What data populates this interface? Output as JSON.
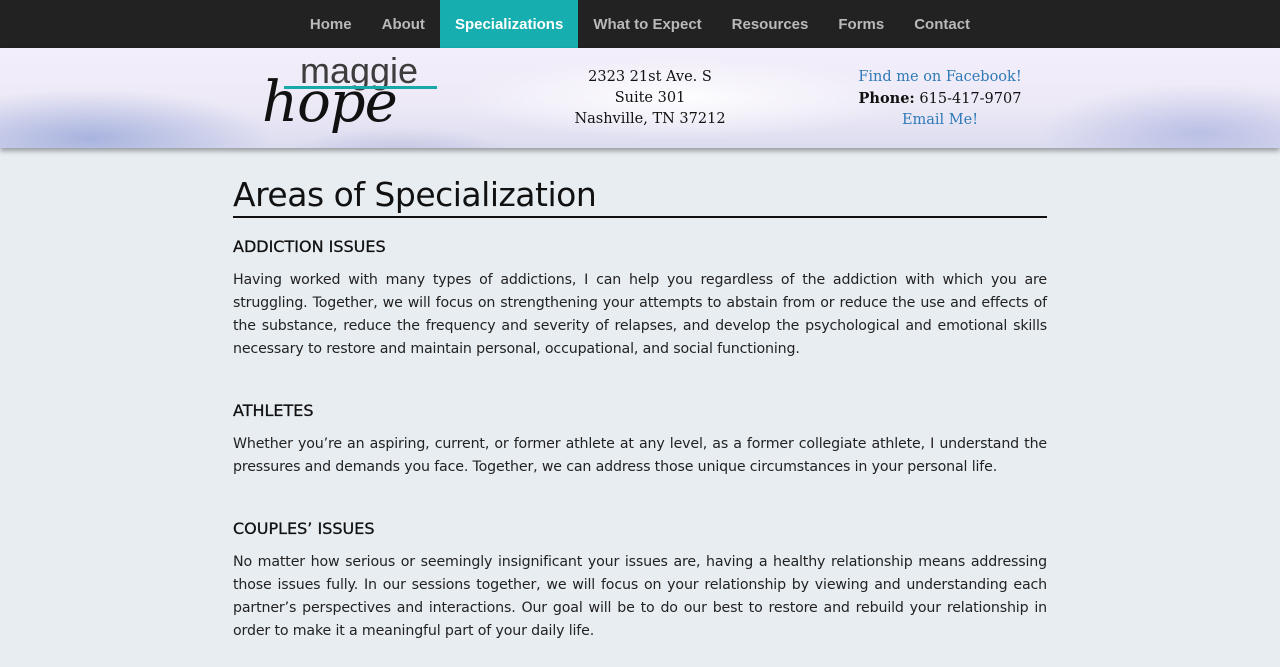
{
  "nav": {
    "items": [
      {
        "label": "Home"
      },
      {
        "label": "About"
      },
      {
        "label": "Specializations"
      },
      {
        "label": "What to Expect"
      },
      {
        "label": "Resources"
      },
      {
        "label": "Forms"
      },
      {
        "label": "Contact"
      }
    ],
    "active": "Specializations"
  },
  "header": {
    "logo": {
      "line1": "maggie",
      "line2": "hope"
    },
    "address": {
      "line1": "2323 21st Ave. S",
      "line2": "Suite 301",
      "line3": "Nashville, TN 37212"
    },
    "contact": {
      "facebook": "Find me on Facebook!",
      "phone_label": "Phone:",
      "phone": "615-417-9707",
      "email": "Email Me!"
    }
  },
  "main": {
    "title": "Areas of Specialization",
    "sections": [
      {
        "heading": "ADDICTION ISSUES",
        "body": "Having worked with many types of addictions, I can help you regardless of the addiction with which you are struggling. Together, we will focus on strengthening your attempts to abstain from or reduce the use and effects of the substance, reduce the frequency and severity of relapses, and develop the psychological and emotional skills necessary to restore and maintain personal, occupational, and social functioning."
      },
      {
        "heading": "ATHLETES",
        "body": "Whether you’re an aspiring, current, or former athlete at any level, as a former collegiate athlete, I understand the pressures and demands you face. Together, we can address those unique circumstances in your personal life."
      },
      {
        "heading": "COUPLES’ ISSUES",
        "body": "No matter how serious or seemingly insignificant your issues are, having a healthy relationship means addressing those issues fully. In our sessions together, we will focus on your relationship by viewing and understanding each partner’s perspectives and interactions. Our goal will be to do our best to restore and rebuild your relationship in order to make it a meaningful part of your daily life."
      }
    ]
  },
  "colors": {
    "nav_bg": "#222222",
    "nav_active": "#16aeae",
    "link": "#2f7ab8",
    "page_bg": "#e8edf2"
  }
}
